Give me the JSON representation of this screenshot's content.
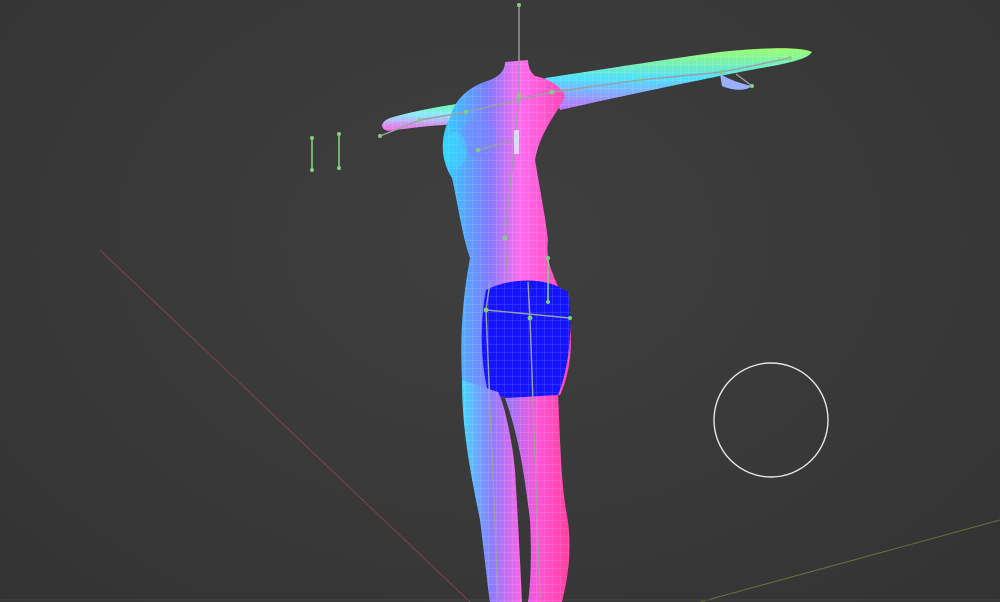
{
  "viewport": {
    "label": "3D viewport",
    "colors": {
      "background": "#3a3a3a",
      "grid_floor": "#454545",
      "x_axis": "#9b4a4a",
      "y_axis": "#7a8a3a",
      "bone": "#9aa0a6",
      "bone_joint": "#7fd17f",
      "shorts": "#1414ff",
      "brush_circle": "#e6e6e6"
    },
    "icons": {
      "brush_cursor": "circle-brush-cursor-icon",
      "empty_bones": "bone-stick-icon"
    }
  }
}
